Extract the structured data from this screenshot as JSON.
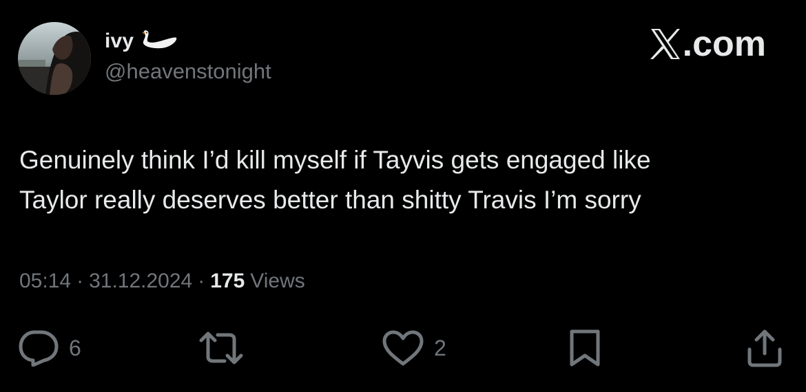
{
  "author": {
    "display_name": "ivy",
    "emoji_icon": "swan-icon",
    "handle": "@heavenstonight"
  },
  "brand": {
    "label": ".com",
    "icon": "x-logo-icon"
  },
  "tweet": {
    "text": "Genuinely think I’d kill myself if Tayvis gets engaged like\nTaylor really deserves better than shitty Travis I’m sorry"
  },
  "meta": {
    "time": "05:14",
    "date": "31.12.2024",
    "separator": "·",
    "views_count": "175",
    "views_label": "Views"
  },
  "actions": {
    "reply_count": "6",
    "like_count": "2"
  },
  "colors": {
    "background": "#000000",
    "text": "#e7e9ea",
    "secondary": "#71767b"
  }
}
